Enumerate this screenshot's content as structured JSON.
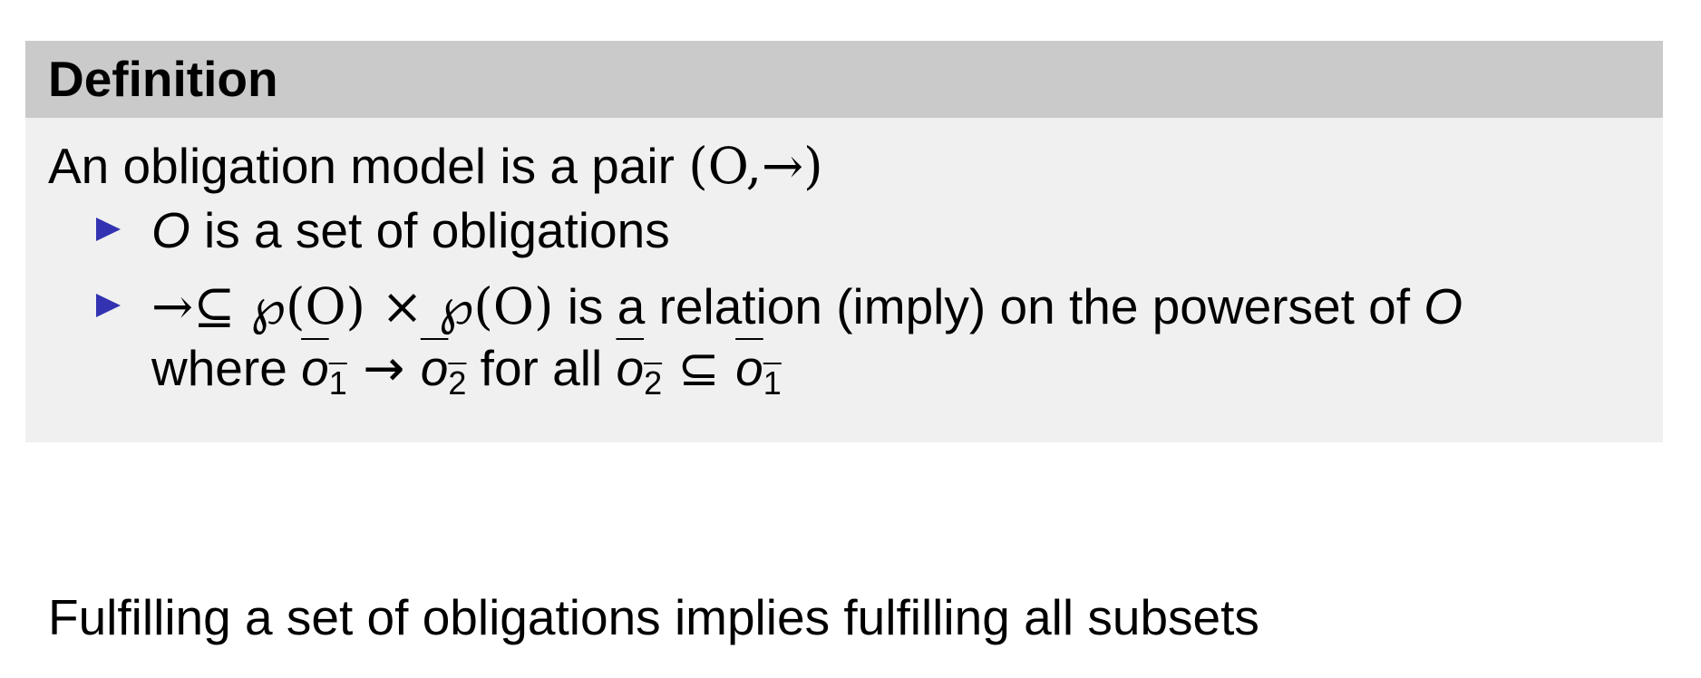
{
  "definition": {
    "title": "Definition",
    "intro": {
      "text": "An obligation model is a pair ",
      "math": "(O,→)"
    },
    "items": [
      {
        "math_start": "O",
        "text": " is a set of obligations"
      },
      {
        "line1_math": "→⊆ ℘(O) × ℘(O)",
        "line1_text": " is a relation (imply) on the powerset of ",
        "line1_end_math": "O",
        "line2_where": "where ",
        "o1": "o",
        "o1_sub": "1",
        "arrow": " → ",
        "o2": "o",
        "o2_sub": "2",
        "for_all": " for all ",
        "o2b": "o",
        "o2b_sub": "2",
        "subseteq": " ⊆ ",
        "o1b": "o",
        "o1b_sub": "1"
      }
    ]
  },
  "footer": {
    "text": "Fulfilling a set of obligations implies fulfilling all subsets"
  },
  "colors": {
    "header_bg": "#cacaca",
    "body_bg": "#f0f0f0",
    "bullet": "#3333b2"
  }
}
